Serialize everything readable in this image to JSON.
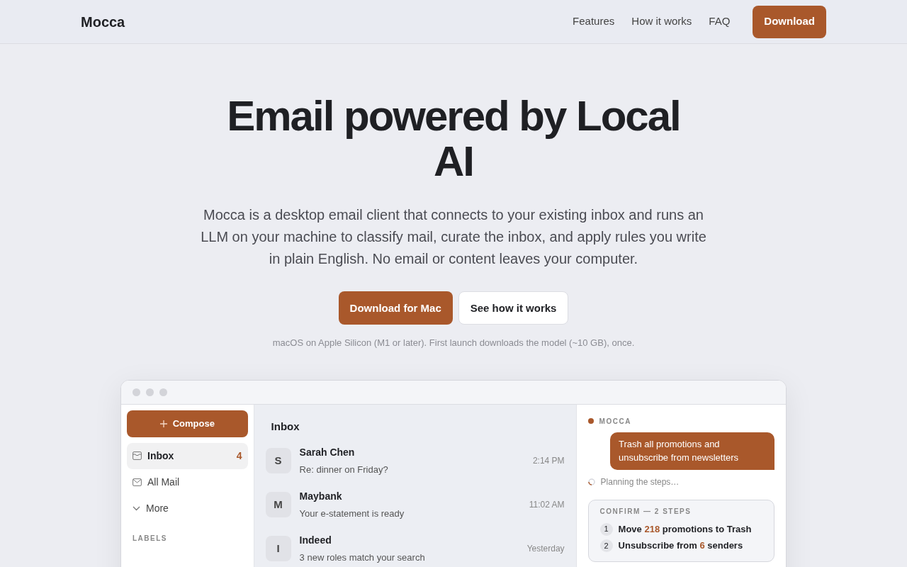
{
  "navbar": {
    "brand": "Mocca",
    "links": [
      "Features",
      "How it works",
      "FAQ"
    ],
    "cta": "Download"
  },
  "hero": {
    "title": "Email powered by Local AI",
    "lead": "Mocca is a desktop email client that connects to your existing inbox and runs an LLM on your machine to classify mail, curate the inbox, and apply rules you write in plain English. No email or content leaves your computer.",
    "buttons": [
      {
        "label": "Download for Mac",
        "kind": "primary"
      },
      {
        "label": "See how it works",
        "kind": "secondary"
      }
    ],
    "note": "macOS on Apple Silicon (M1 or later). First launch downloads the model (~10 GB), once."
  },
  "app": {
    "sidebar": {
      "compose": "Compose",
      "items": [
        {
          "label": "Inbox",
          "count": "4",
          "selected": true,
          "kind": "inbox"
        },
        {
          "label": "All Mail",
          "selected": false,
          "kind": "mail"
        },
        {
          "label": "More",
          "selected": false,
          "kind": "more"
        }
      ],
      "labels_heading": "LABELS"
    },
    "list": {
      "title": "Inbox",
      "messages": [
        {
          "initial": "S",
          "sender": "Sarah Chen",
          "subject": "Re: dinner on Friday?",
          "time": "2:14 PM"
        },
        {
          "initial": "M",
          "sender": "Maybank",
          "subject": "Your e-statement is ready",
          "time": "11:02 AM"
        },
        {
          "initial": "I",
          "sender": "Indeed",
          "subject": "3 new roles match your search",
          "time": "Yesterday"
        }
      ]
    },
    "assistant": {
      "name": "MOCCA",
      "request": "Trash all promotions and unsubscribe from newsletters",
      "status": "Planning the steps…",
      "confirm": {
        "heading": "CONFIRM — 2 STEPS",
        "steps": [
          {
            "number": "1",
            "text": "Move **218** promotions to Trash"
          },
          {
            "number": "2",
            "text": "Unsubscribe from **6** senders"
          }
        ]
      }
    }
  }
}
